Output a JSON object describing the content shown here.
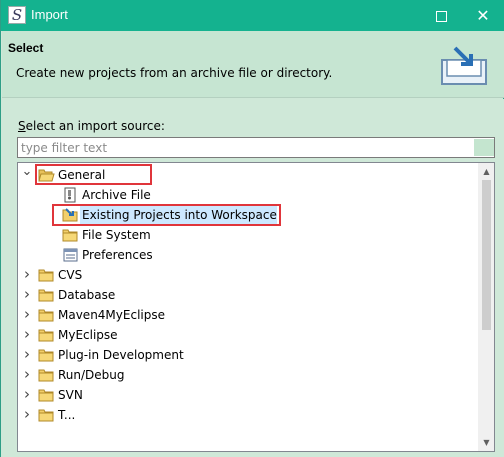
{
  "window": {
    "title": "Import",
    "app_icon_glyph": "S",
    "maximize_glyph": "",
    "close_glyph": "✕"
  },
  "banner": {
    "title": "Select",
    "description": "Create new projects from an archive file or directory."
  },
  "source": {
    "label_mnemonic": "S",
    "label_rest": "elect an import source:",
    "filter_placeholder": "type filter text",
    "filter_value": ""
  },
  "tree": {
    "items": [
      {
        "label": "General",
        "expanded": true,
        "level": 0,
        "icon": "folder-open-icon"
      },
      {
        "label": "Archive File",
        "level": 1,
        "icon": "archive-file-icon"
      },
      {
        "label": "Existing Projects into Workspace",
        "level": 1,
        "icon": "project-folder-icon",
        "selected": true
      },
      {
        "label": "File System",
        "level": 1,
        "icon": "folder-icon"
      },
      {
        "label": "Preferences",
        "level": 1,
        "icon": "preferences-icon"
      },
      {
        "label": "CVS",
        "expanded": false,
        "level": 0,
        "icon": "folder-icon"
      },
      {
        "label": "Database",
        "expanded": false,
        "level": 0,
        "icon": "folder-icon"
      },
      {
        "label": "Maven4MyEclipse",
        "expanded": false,
        "level": 0,
        "icon": "folder-icon"
      },
      {
        "label": "MyEclipse",
        "expanded": false,
        "level": 0,
        "icon": "folder-icon"
      },
      {
        "label": "Plug-in Development",
        "expanded": false,
        "level": 0,
        "icon": "folder-icon"
      },
      {
        "label": "Run/Debug",
        "expanded": false,
        "level": 0,
        "icon": "folder-icon"
      },
      {
        "label": "SVN",
        "expanded": false,
        "level": 0,
        "icon": "folder-icon"
      },
      {
        "label": "T...",
        "expanded": false,
        "level": 0,
        "icon": "folder-icon"
      }
    ],
    "twisty_expanded": "⌄",
    "twisty_collapsed": "›"
  },
  "colors": {
    "titlebar": "#14b28f",
    "banner": "#c6e5d2",
    "highlight_box": "#e0353b",
    "selection": "#cce8ff",
    "folder": "#e8c15b"
  }
}
